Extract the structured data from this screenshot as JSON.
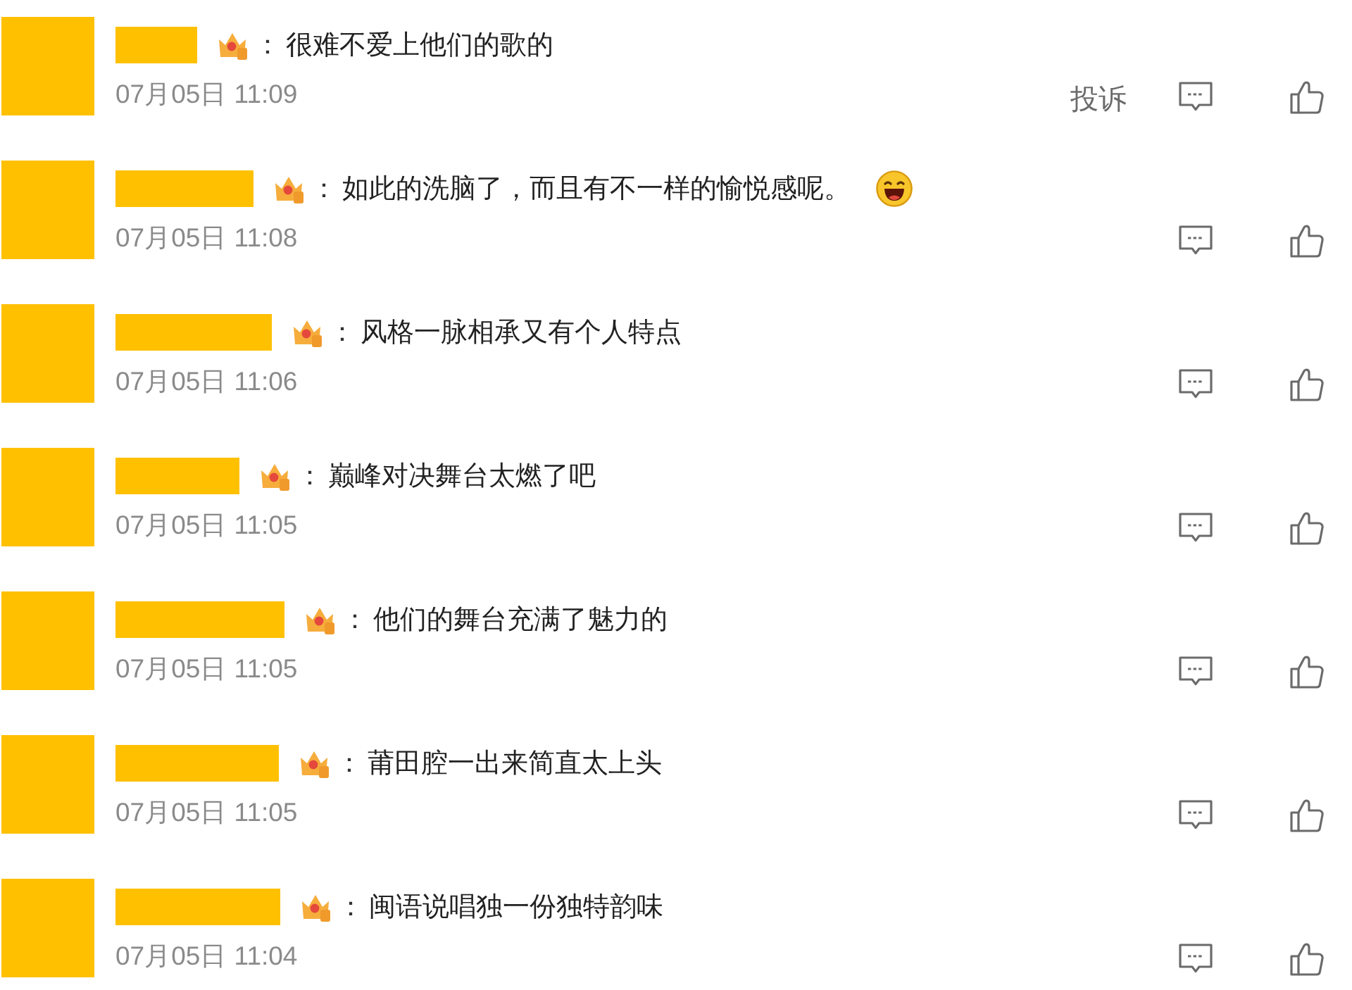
{
  "comments": [
    {
      "separator": "：",
      "text": "很难不爱上他们的歌的",
      "emoji": false,
      "time": "07月05日 11:09",
      "report": "投诉"
    },
    {
      "separator": "：",
      "text": "如此的洗脑了，而且有不一样的愉悦感呢。",
      "emoji": true,
      "time": "07月05日 11:08"
    },
    {
      "separator": "：",
      "text": "风格一脉相承又有个人特点",
      "emoji": false,
      "time": "07月05日 11:06"
    },
    {
      "separator": "：",
      "text": "巅峰对决舞台太燃了吧",
      "emoji": false,
      "time": "07月05日 11:05"
    },
    {
      "separator": "：",
      "text": "他们的舞台充满了魅力的",
      "emoji": false,
      "time": "07月05日 11:05"
    },
    {
      "separator": "：",
      "text": "莆田腔一出来简直太上头",
      "emoji": false,
      "time": "07月05日 11:05"
    },
    {
      "separator": "：",
      "text": "闽语说唱独一份独特韵味",
      "emoji": false,
      "time": "07月05日 11:04"
    }
  ]
}
